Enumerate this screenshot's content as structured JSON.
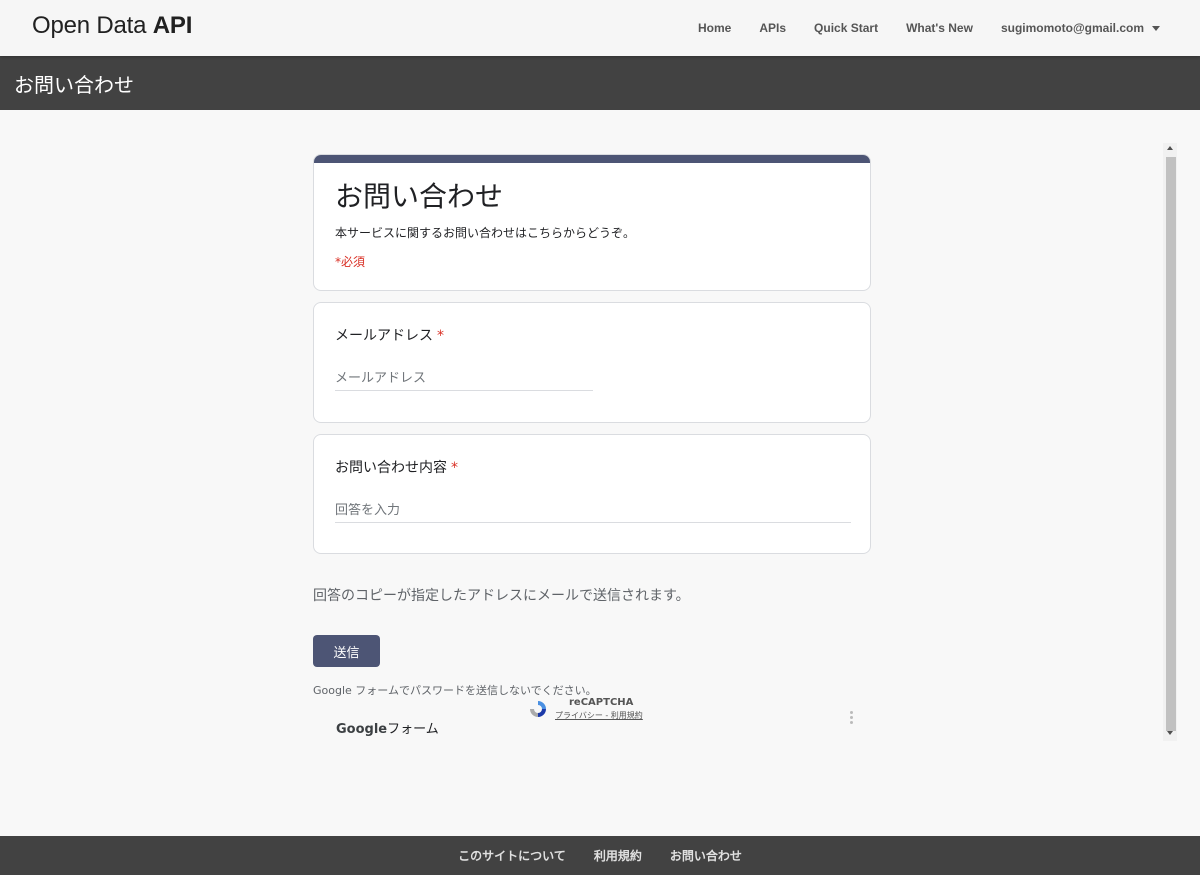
{
  "header": {
    "brand_regular": "Open Data ",
    "brand_bold": "API",
    "nav": [
      {
        "label": "Home"
      },
      {
        "label": "APIs"
      },
      {
        "label": "Quick Start"
      },
      {
        "label": "What's New"
      }
    ],
    "user_email": "sugimomoto@gmail.com"
  },
  "page_title": "お問い合わせ",
  "form": {
    "title": "お問い合わせ",
    "description": "本サービスに関するお問い合わせはこちらからどうぞ。",
    "required_note": "*必須",
    "questions": [
      {
        "label": "メールアドレス",
        "required_mark": "*",
        "placeholder": "メールアドレス"
      },
      {
        "label": "お問い合わせ内容",
        "required_mark": "*",
        "placeholder": "回答を入力"
      }
    ],
    "copy_note": "回答のコピーが指定したアドレスにメールで送信されます。",
    "submit_label": "送信",
    "password_warning": "Google フォームでパスワードを送信しないでください。",
    "recaptcha_label": "reCAPTCHA",
    "recaptcha_links": "プライバシー - 利用規約",
    "google_forms_brand": "Google",
    "google_forms_suffix": "フォーム"
  },
  "footer": {
    "links": [
      {
        "label": "このサイトについて"
      },
      {
        "label": "利用規約"
      },
      {
        "label": "お問い合わせ"
      }
    ]
  },
  "colors": {
    "accent": "#4d5575",
    "required": "#d93025",
    "titlebar": "#424242"
  }
}
